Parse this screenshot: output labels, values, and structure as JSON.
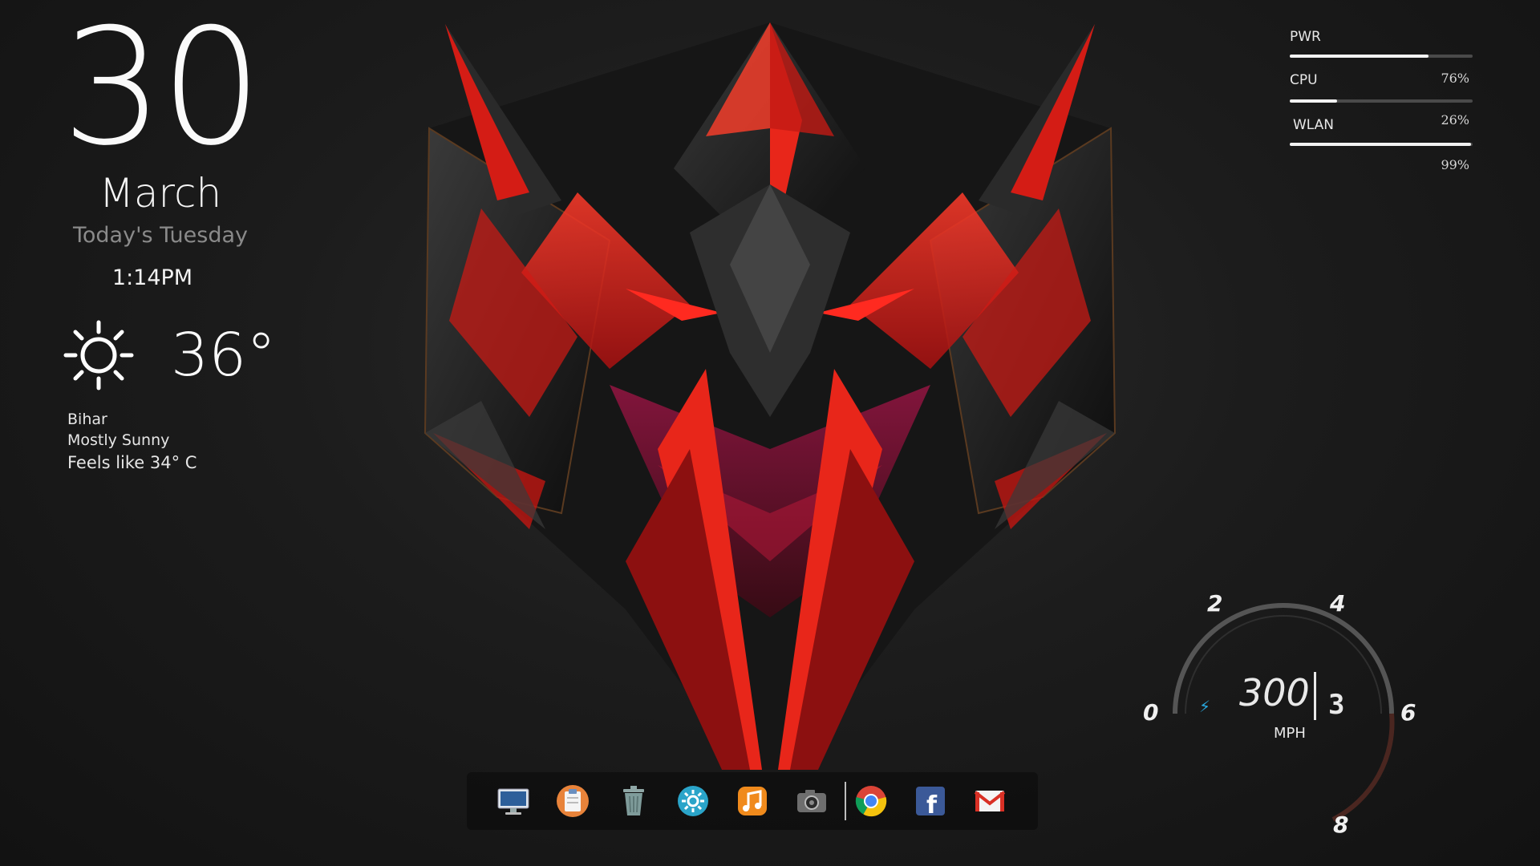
{
  "clock": {
    "day": "30",
    "month": "March",
    "weekday": "Today's Tuesday",
    "time": "1:14PM"
  },
  "weather": {
    "icon": "sun-icon",
    "temperature": "36°",
    "location": "Bihar",
    "condition": "Mostly Sunny",
    "feels_like": "Feels like 34° C"
  },
  "system_monitor": [
    {
      "label": "PWR",
      "percent_text": "76%",
      "level": 0.76
    },
    {
      "label": "CPU",
      "percent_text": "26%",
      "level": 0.26
    },
    {
      "label": "WLAN",
      "percent_text": "99%",
      "level": 0.99
    }
  ],
  "speedometer": {
    "ticks": [
      "0",
      "2",
      "4",
      "6",
      "8"
    ],
    "speed": "300",
    "unit": "MPH",
    "gear": "3",
    "colors": {
      "arc": "#5a5a5a",
      "redline": "#5a2a22",
      "bolt": "#29a9e0"
    }
  },
  "dock": {
    "items": [
      {
        "name": "monitor-icon",
        "label": "Computer"
      },
      {
        "name": "clipboard-icon",
        "label": "Notes"
      },
      {
        "name": "trash-icon",
        "label": "Trash"
      },
      {
        "name": "settings-gear-icon",
        "label": "Settings"
      },
      {
        "name": "music-icon",
        "label": "Music"
      },
      {
        "name": "camera-icon",
        "label": "Camera"
      },
      {
        "name": "chrome-icon",
        "label": "Chrome"
      },
      {
        "name": "facebook-icon",
        "label": "Facebook"
      },
      {
        "name": "gmail-icon",
        "label": "Gmail"
      }
    ]
  },
  "colors": {
    "accent_red": "#e8261a",
    "dark_red": "#7a0d10",
    "wallpaper_bg": "#1c1c1c"
  }
}
